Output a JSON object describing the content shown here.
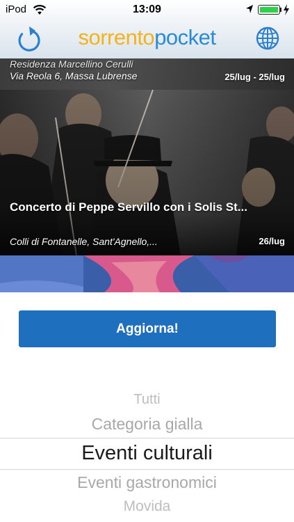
{
  "status_bar": {
    "carrier": "iPod",
    "time": "13:09",
    "battery_level": 1.0
  },
  "nav": {
    "logo_part1": "sorrento",
    "logo_part2": "pocket",
    "logo_color1": "#f4b21b",
    "logo_color2": "#2b8ad6",
    "left_icon": "refresh-icon",
    "right_icon": "globe-icon"
  },
  "events": [
    {
      "title": "Residenza Marcellino Cerulli",
      "location": "Via Reola 6, Massa Lubrense",
      "date": "25/lug - 25/lug"
    },
    {
      "title": "Concerto di Peppe Servillo con i Solis St...",
      "location": "Colli di Fontanelle, Sant'Agnello,...",
      "date": "26/lug"
    }
  ],
  "update_button": {
    "label": "Aggiorna!",
    "color": "#1f6fbf"
  },
  "picker": {
    "options": [
      "Tutti",
      "Categoria gialla",
      "Eventi culturali",
      "Eventi gastronomici",
      "Movida",
      "..."
    ],
    "selected": "Eventi culturali"
  }
}
